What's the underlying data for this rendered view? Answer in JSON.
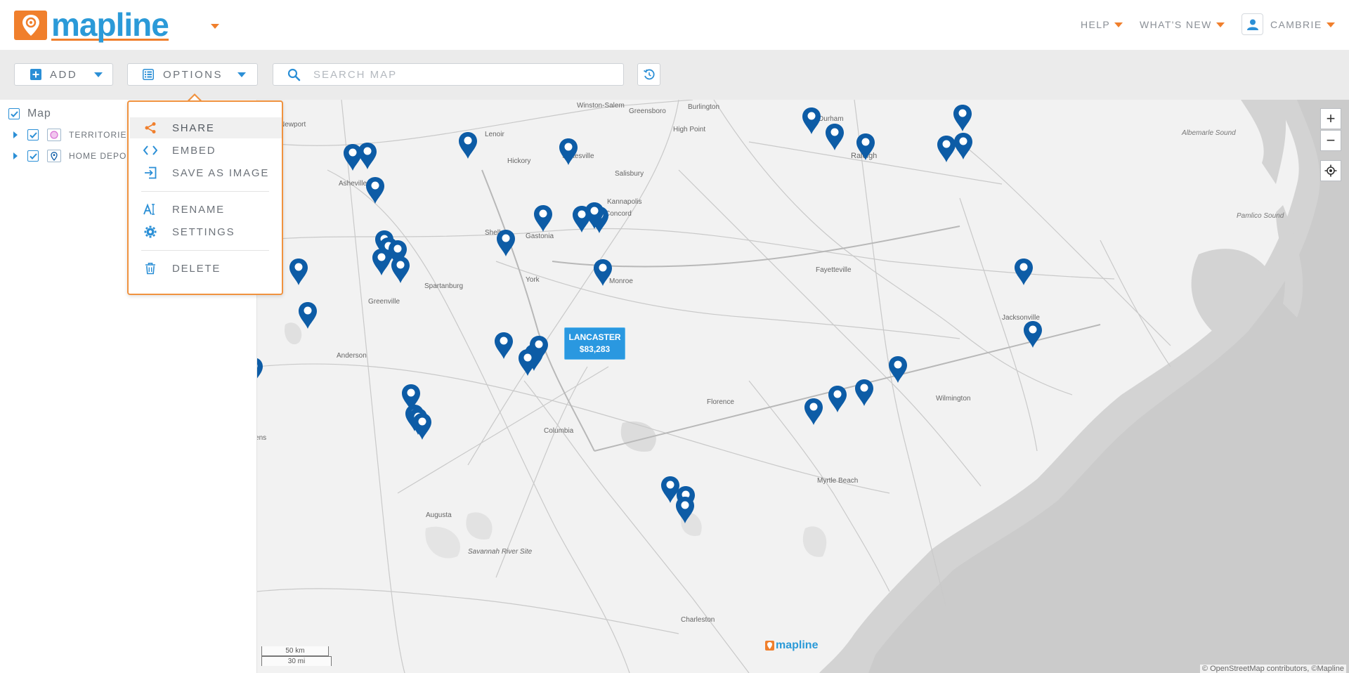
{
  "app": {
    "logo_text": "mapline",
    "brand_color": "#2b9ad8",
    "accent_color": "#f07f2c"
  },
  "header": {
    "help_label": "HELP",
    "whats_new_label": "WHAT'S NEW",
    "user_name": "CAMBRIE",
    "user_icon": "user-icon"
  },
  "toolbar": {
    "add_label": "ADD",
    "add_icon": "plus-square-icon",
    "options_label": "OPTIONS",
    "options_icon": "list-icon",
    "search_placeholder": "SEARCH MAP",
    "search_value": "",
    "search_icon": "search-icon",
    "refresh_icon": "refresh-icon"
  },
  "sidebar": {
    "root_label": "Map",
    "root_checked": true,
    "layers": [
      {
        "label": "TERRITORIE",
        "checked": true,
        "icon": "territory-icon"
      },
      {
        "label": "HOME DEPO",
        "checked": true,
        "icon": "location-pin-icon"
      }
    ]
  },
  "options_menu": {
    "items": [
      {
        "label": "SHARE",
        "icon": "share-icon",
        "active": true
      },
      {
        "label": "EMBED",
        "icon": "code-icon",
        "active": false
      },
      {
        "label": "SAVE AS IMAGE",
        "icon": "export-icon",
        "active": false
      },
      {
        "label": "RENAME",
        "icon": "rename-icon",
        "active": false
      },
      {
        "label": "SETTINGS",
        "icon": "gear-icon",
        "active": false
      },
      {
        "label": "DELETE",
        "icon": "trash-icon",
        "active": false
      }
    ]
  },
  "map": {
    "zoom_in_label": "+",
    "zoom_out_label": "−",
    "locate_icon": "crosshair-icon",
    "tooltip": {
      "name": "LANCASTER",
      "value": "$83,283"
    },
    "scale_km": "50 km",
    "scale_mi": "30 mi",
    "attribution": "© OpenStreetMap contributors, ©Mapline",
    "watermark": "mapline",
    "pin_color": "#0d5ca6",
    "place_labels": [
      "Winston-Salem",
      "Greensboro",
      "Burlington",
      "Durham",
      "Raleigh",
      "High Point",
      "Hickory",
      "Statesville",
      "Salisbury",
      "Kannapolis",
      "Concord",
      "Lenoir",
      "Shelby",
      "Gastonia",
      "Monroe",
      "York",
      "Spartanburg",
      "Greenville",
      "Anderson",
      "Fayetteville",
      "Jacksonville",
      "Wilmington",
      "Florence",
      "Columbia",
      "Myrtle Beach",
      "Augusta",
      "Savannah River Site",
      "Charleston",
      "Albemarle Sound",
      "Pamlico Sound",
      "Athens",
      "Asheville",
      "Newport"
    ]
  }
}
